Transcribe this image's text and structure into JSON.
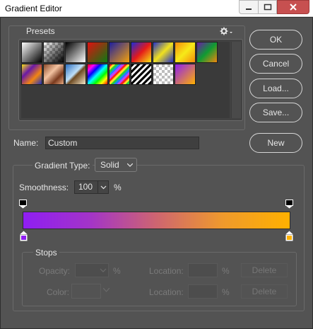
{
  "window": {
    "title": "Gradient Editor"
  },
  "presets": {
    "label": "Presets",
    "settings_icon": "gear-icon"
  },
  "buttons": {
    "ok": "OK",
    "cancel": "Cancel",
    "load": "Load...",
    "save": "Save...",
    "new": "New"
  },
  "name": {
    "label": "Name:",
    "value": "Custom"
  },
  "gradient_type": {
    "label": "Gradient Type:",
    "value": "Solid"
  },
  "smoothness": {
    "label": "Smoothness:",
    "value": "100",
    "unit": "%"
  },
  "gradient": {
    "start_color": "#8f1ef2",
    "end_color": "#ffb100"
  },
  "stops": {
    "label": "Stops",
    "opacity_label": "Opacity:",
    "opacity_value": "",
    "opacity_unit": "%",
    "opacity_location_label": "Location:",
    "opacity_location_value": "",
    "opacity_location_unit": "%",
    "opacity_delete": "Delete",
    "color_label": "Color:",
    "color_location_label": "Location:",
    "color_location_value": "",
    "color_location_unit": "%",
    "color_delete": "Delete"
  },
  "colors": {
    "dialog_bg": "#535353",
    "purple": "#8f1ef2",
    "orange": "#ffb100"
  }
}
